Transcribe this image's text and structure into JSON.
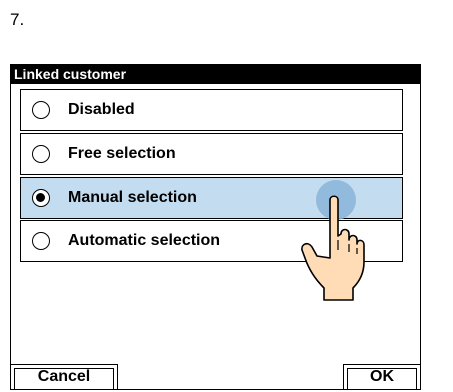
{
  "step": {
    "number": "7."
  },
  "dialog": {
    "title": "Linked customer",
    "options": [
      {
        "label": "Disabled",
        "selected": false
      },
      {
        "label": "Free selection",
        "selected": false
      },
      {
        "label": "Manual selection",
        "selected": true
      },
      {
        "label": "Automatic selection",
        "selected": false
      }
    ],
    "cancel_label": "Cancel",
    "ok_label": "OK"
  },
  "colors": {
    "selected_row": "#c3dcef",
    "title_bar": "#000000",
    "touch_marker": "#8ab4d8"
  },
  "icons": {
    "pointer": "hand-pointer-icon"
  }
}
